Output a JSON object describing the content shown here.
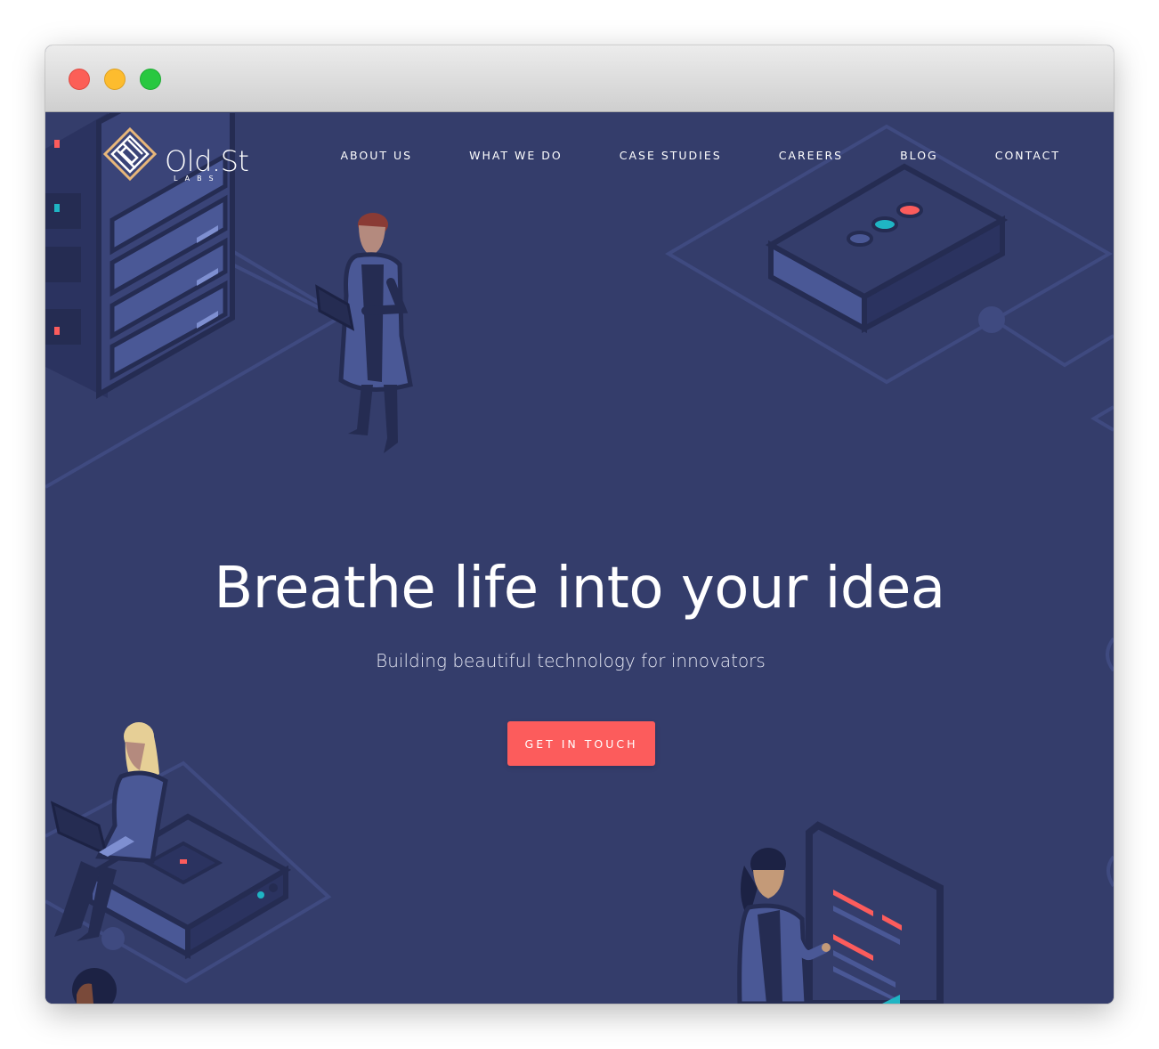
{
  "window": {
    "controls": [
      "close",
      "minimize",
      "maximize"
    ]
  },
  "brand": {
    "name": "Old.St",
    "tagline": "LABS",
    "icon": "diamond-maze-logo-icon"
  },
  "nav": {
    "items": [
      {
        "label": "ABOUT US"
      },
      {
        "label": "WHAT WE DO"
      },
      {
        "label": "CASE STUDIES"
      },
      {
        "label": "CAREERS"
      },
      {
        "label": "BLOG"
      },
      {
        "label": "CONTACT"
      }
    ]
  },
  "hero": {
    "title": "Breathe life into your idea",
    "subtitle": "Building beautiful technology for innovators",
    "cta_label": "GET IN TOUCH"
  },
  "colors": {
    "background": "#343d6b",
    "accent": "#fc5c5c",
    "illustration_dark": "#252c52",
    "illustration_mid": "#4a5896",
    "illustration_line": "#3f4a80",
    "logo_gold": "#e8b77a",
    "teal": "#1fb5c4"
  }
}
